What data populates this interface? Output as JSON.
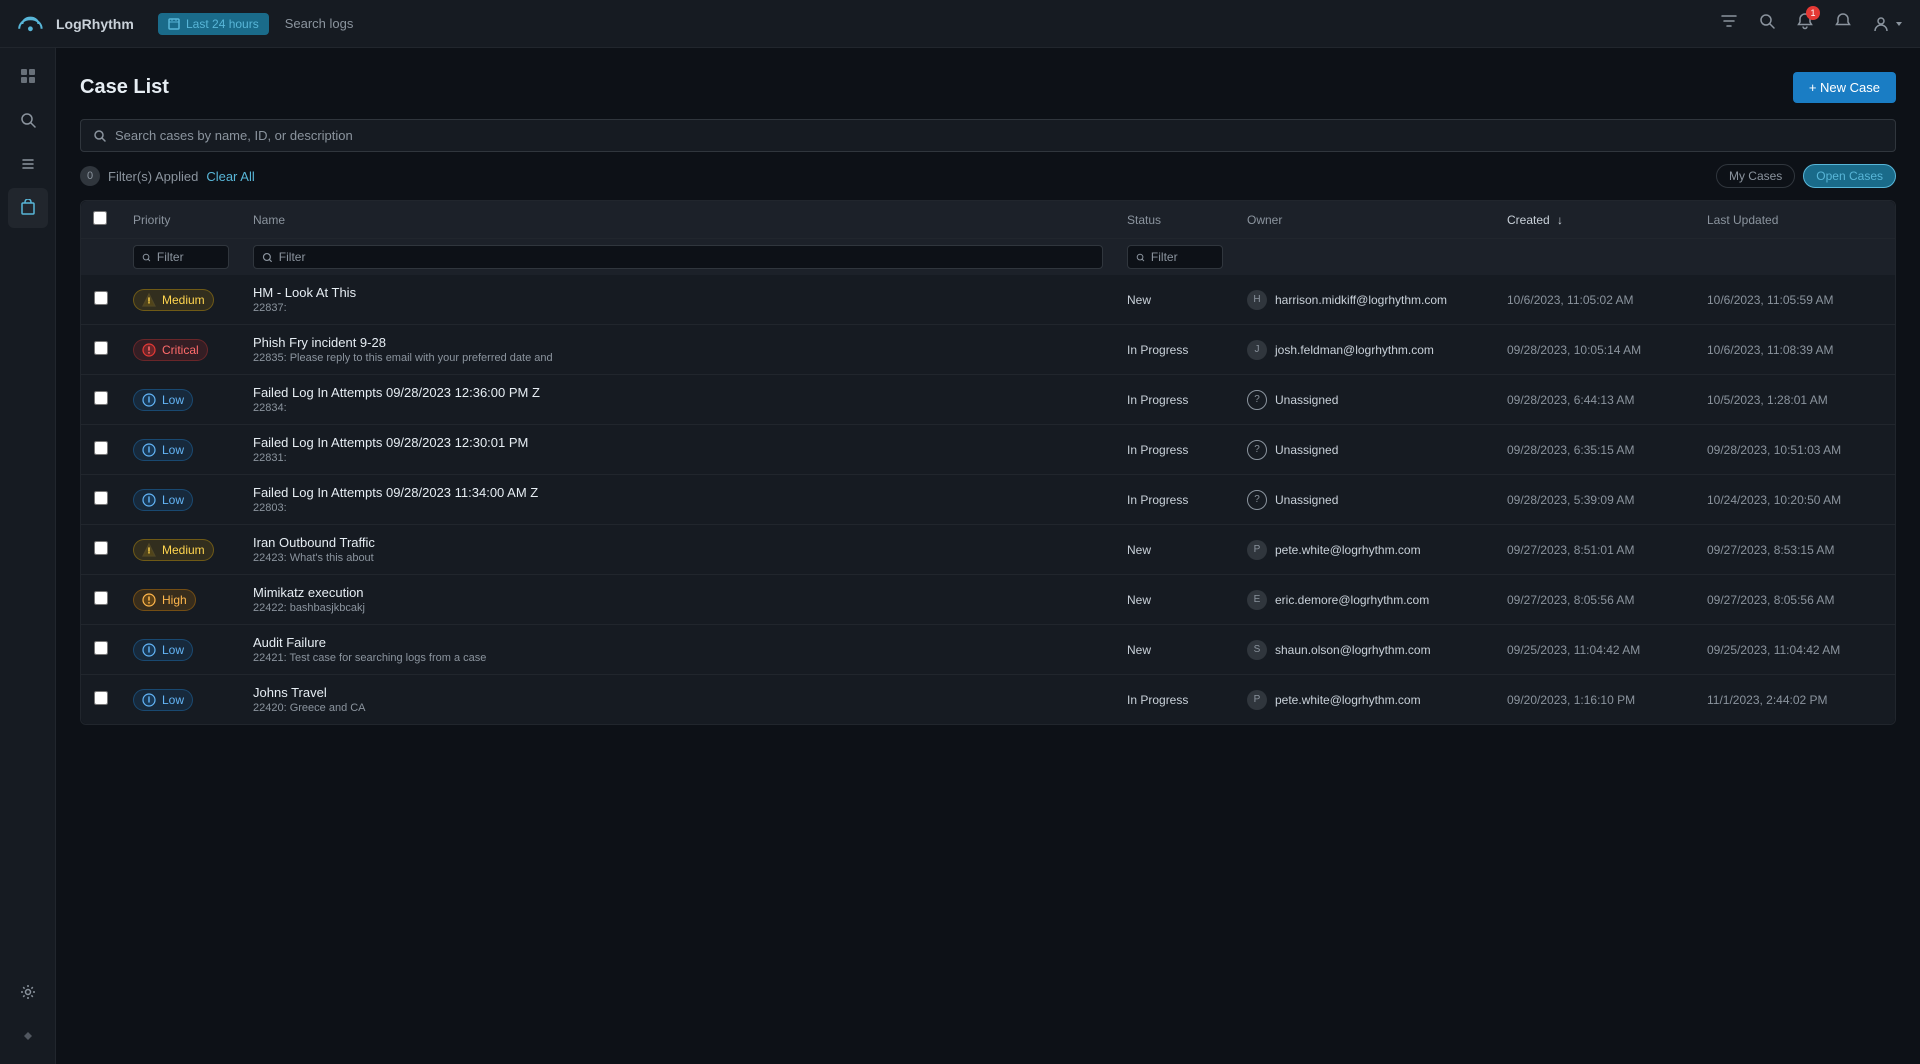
{
  "app": {
    "name": "LogRhythm",
    "time_range": "Last 24 hours",
    "search_placeholder": "Search logs"
  },
  "header": {
    "title": "Case List",
    "new_case_label": "+ New Case"
  },
  "search": {
    "placeholder": "Search cases by name, ID, or description"
  },
  "filters": {
    "applied_count": "0",
    "applied_label": "Filter(s) Applied",
    "clear_all": "Clear All",
    "my_cases": "My Cases",
    "open_cases": "Open Cases"
  },
  "table": {
    "columns": {
      "priority": "Priority",
      "name": "Name",
      "status": "Status",
      "owner": "Owner",
      "created": "Created",
      "last_updated": "Last Updated"
    },
    "filter_placeholder": "Filter"
  },
  "cases": [
    {
      "id": "22837",
      "name": "HM - Look At This",
      "description": "",
      "priority": "Medium",
      "status": "New",
      "owner": "harrison.midkiff@logrhythm.com",
      "created": "10/6/2023, 11:05:02 AM",
      "updated": "10/6/2023, 11:05:59 AM"
    },
    {
      "id": "22835",
      "name": "Phish Fry incident 9-28",
      "description": "Please reply to this email with your preferred date and",
      "priority": "Critical",
      "status": "In Progress",
      "owner": "josh.feldman@logrhythm.com",
      "created": "09/28/2023, 10:05:14 AM",
      "updated": "10/6/2023, 11:08:39 AM"
    },
    {
      "id": "22834",
      "name": "Failed Log In Attempts 09/28/2023 12:36:00 PM Z",
      "description": "",
      "priority": "Low",
      "status": "In Progress",
      "owner": "Unassigned",
      "created": "09/28/2023, 6:44:13 AM",
      "updated": "10/5/2023, 1:28:01 AM"
    },
    {
      "id": "22831",
      "name": "Failed Log In Attempts 09/28/2023 12:30:01 PM",
      "description": "",
      "priority": "Low",
      "status": "In Progress",
      "owner": "Unassigned",
      "created": "09/28/2023, 6:35:15 AM",
      "updated": "09/28/2023, 10:51:03 AM"
    },
    {
      "id": "22803",
      "name": "Failed Log In Attempts 09/28/2023 11:34:00 AM Z",
      "description": "",
      "priority": "Low",
      "status": "In Progress",
      "owner": "Unassigned",
      "created": "09/28/2023, 5:39:09 AM",
      "updated": "10/24/2023, 10:20:50 AM"
    },
    {
      "id": "22423",
      "name": "Iran Outbound Traffic",
      "description": "What's this about",
      "priority": "Medium",
      "status": "New",
      "owner": "pete.white@logrhythm.com",
      "created": "09/27/2023, 8:51:01 AM",
      "updated": "09/27/2023, 8:53:15 AM"
    },
    {
      "id": "22422",
      "name": "Mimikatz execution",
      "description": "bashbasjkbcakj",
      "priority": "High",
      "status": "New",
      "owner": "eric.demore@logrhythm.com",
      "created": "09/27/2023, 8:05:56 AM",
      "updated": "09/27/2023, 8:05:56 AM"
    },
    {
      "id": "22421",
      "name": "Audit Failure",
      "description": "Test case for searching logs from a case",
      "priority": "Low",
      "status": "New",
      "owner": "shaun.olson@logrhythm.com",
      "created": "09/25/2023, 11:04:42 AM",
      "updated": "09/25/2023, 11:04:42 AM"
    },
    {
      "id": "22420",
      "name": "Johns Travel",
      "description": "Greece and CA",
      "priority": "Low",
      "status": "In Progress",
      "owner": "pete.white@logrhythm.com",
      "created": "09/20/2023, 1:16:10 PM",
      "updated": "11/1/2023, 2:44:02 PM"
    }
  ]
}
